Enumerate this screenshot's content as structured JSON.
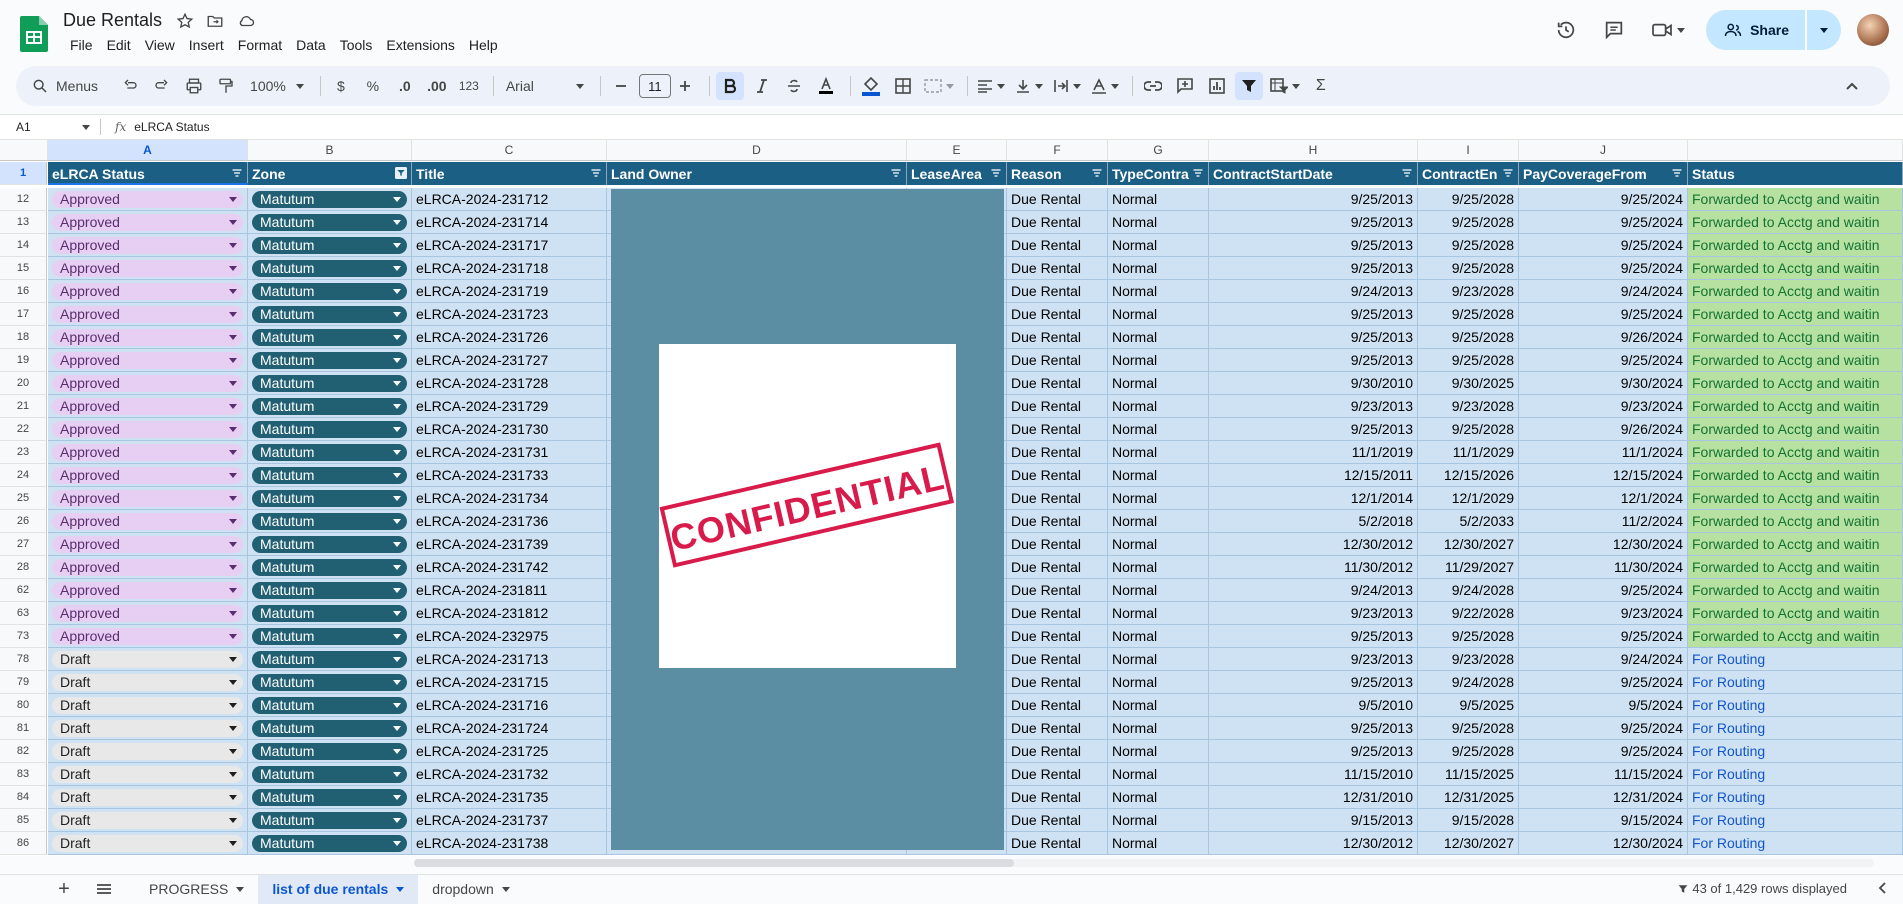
{
  "app": {
    "title": "Due Rentals"
  },
  "menu": [
    "File",
    "Edit",
    "View",
    "Insert",
    "Format",
    "Data",
    "Tools",
    "Extensions",
    "Help"
  ],
  "header": {
    "share_label": "Share"
  },
  "toolbar": {
    "search_label": "Menus",
    "zoom": "100%",
    "currency": "$",
    "percent": "%",
    "dec_dec": ".0",
    "inc_dec": ".00",
    "num_format": "123",
    "font": "Arial",
    "font_size": "11"
  },
  "formula": {
    "cell_ref": "A1",
    "content": "eLRCA Status"
  },
  "columns": [
    "A",
    "B",
    "C",
    "D",
    "E",
    "F",
    "G",
    "H",
    "I",
    "J"
  ],
  "header_row": {
    "row": "1",
    "cells": [
      "eLRCA Status",
      "Zone",
      "Title",
      "Land Owner",
      "LeaseArea",
      "Reason",
      "TypeContra",
      "ContractStartDate",
      "ContractEn",
      "PayCoverageFrom",
      "Status"
    ]
  },
  "rows": [
    {
      "n": "12",
      "status": "Approved",
      "zone": "Matutum",
      "title": "eLRCA-2024-231712",
      "reason": "Due Rental",
      "type": "Normal",
      "start": "9/25/2013",
      "end": "9/25/2028",
      "pay": "9/25/2024",
      "st": "Forwarded to Acctg and waitin"
    },
    {
      "n": "13",
      "status": "Approved",
      "zone": "Matutum",
      "title": "eLRCA-2024-231714",
      "reason": "Due Rental",
      "type": "Normal",
      "start": "9/25/2013",
      "end": "9/25/2028",
      "pay": "9/25/2024",
      "st": "Forwarded to Acctg and waitin"
    },
    {
      "n": "14",
      "status": "Approved",
      "zone": "Matutum",
      "title": "eLRCA-2024-231717",
      "reason": "Due Rental",
      "type": "Normal",
      "start": "9/25/2013",
      "end": "9/25/2028",
      "pay": "9/25/2024",
      "st": "Forwarded to Acctg and waitin"
    },
    {
      "n": "15",
      "status": "Approved",
      "zone": "Matutum",
      "title": "eLRCA-2024-231718",
      "reason": "Due Rental",
      "type": "Normal",
      "start": "9/25/2013",
      "end": "9/25/2028",
      "pay": "9/25/2024",
      "st": "Forwarded to Acctg and waitin"
    },
    {
      "n": "16",
      "status": "Approved",
      "zone": "Matutum",
      "title": "eLRCA-2024-231719",
      "reason": "Due Rental",
      "type": "Normal",
      "start": "9/24/2013",
      "end": "9/23/2028",
      "pay": "9/24/2024",
      "st": "Forwarded to Acctg and waitin"
    },
    {
      "n": "17",
      "status": "Approved",
      "zone": "Matutum",
      "title": "eLRCA-2024-231723",
      "reason": "Due Rental",
      "type": "Normal",
      "start": "9/25/2013",
      "end": "9/25/2028",
      "pay": "9/25/2024",
      "st": "Forwarded to Acctg and waitin"
    },
    {
      "n": "18",
      "status": "Approved",
      "zone": "Matutum",
      "title": "eLRCA-2024-231726",
      "reason": "Due Rental",
      "type": "Normal",
      "start": "9/25/2013",
      "end": "9/25/2028",
      "pay": "9/26/2024",
      "st": "Forwarded to Acctg and waitin"
    },
    {
      "n": "19",
      "status": "Approved",
      "zone": "Matutum",
      "title": "eLRCA-2024-231727",
      "reason": "Due Rental",
      "type": "Normal",
      "start": "9/25/2013",
      "end": "9/25/2028",
      "pay": "9/25/2024",
      "st": "Forwarded to Acctg and waitin"
    },
    {
      "n": "20",
      "status": "Approved",
      "zone": "Matutum",
      "title": "eLRCA-2024-231728",
      "reason": "Due Rental",
      "type": "Normal",
      "start": "9/30/2010",
      "end": "9/30/2025",
      "pay": "9/30/2024",
      "st": "Forwarded to Acctg and waitin"
    },
    {
      "n": "21",
      "status": "Approved",
      "zone": "Matutum",
      "title": "eLRCA-2024-231729",
      "reason": "Due Rental",
      "type": "Normal",
      "start": "9/23/2013",
      "end": "9/23/2028",
      "pay": "9/23/2024",
      "st": "Forwarded to Acctg and waitin"
    },
    {
      "n": "22",
      "status": "Approved",
      "zone": "Matutum",
      "title": "eLRCA-2024-231730",
      "reason": "Due Rental",
      "type": "Normal",
      "start": "9/25/2013",
      "end": "9/25/2028",
      "pay": "9/26/2024",
      "st": "Forwarded to Acctg and waitin"
    },
    {
      "n": "23",
      "status": "Approved",
      "zone": "Matutum",
      "title": "eLRCA-2024-231731",
      "reason": "Due Rental",
      "type": "Normal",
      "start": "11/1/2019",
      "end": "11/1/2029",
      "pay": "11/1/2024",
      "st": "Forwarded to Acctg and waitin"
    },
    {
      "n": "24",
      "status": "Approved",
      "zone": "Matutum",
      "title": "eLRCA-2024-231733",
      "reason": "Due Rental",
      "type": "Normal",
      "start": "12/15/2011",
      "end": "12/15/2026",
      "pay": "12/15/2024",
      "st": "Forwarded to Acctg and waitin"
    },
    {
      "n": "25",
      "status": "Approved",
      "zone": "Matutum",
      "title": "eLRCA-2024-231734",
      "reason": "Due Rental",
      "type": "Normal",
      "start": "12/1/2014",
      "end": "12/1/2029",
      "pay": "12/1/2024",
      "st": "Forwarded to Acctg and waitin"
    },
    {
      "n": "26",
      "status": "Approved",
      "zone": "Matutum",
      "title": "eLRCA-2024-231736",
      "reason": "Due Rental",
      "type": "Normal",
      "start": "5/2/2018",
      "end": "5/2/2033",
      "pay": "11/2/2024",
      "st": "Forwarded to Acctg and waitin"
    },
    {
      "n": "27",
      "status": "Approved",
      "zone": "Matutum",
      "title": "eLRCA-2024-231739",
      "reason": "Due Rental",
      "type": "Normal",
      "start": "12/30/2012",
      "end": "12/30/2027",
      "pay": "12/30/2024",
      "st": "Forwarded to Acctg and waitin"
    },
    {
      "n": "28",
      "status": "Approved",
      "zone": "Matutum",
      "title": "eLRCA-2024-231742",
      "reason": "Due Rental",
      "type": "Normal",
      "start": "11/30/2012",
      "end": "11/29/2027",
      "pay": "11/30/2024",
      "st": "Forwarded to Acctg and waitin"
    },
    {
      "n": "62",
      "status": "Approved",
      "zone": "Matutum",
      "title": "eLRCA-2024-231811",
      "reason": "Due Rental",
      "type": "Normal",
      "start": "9/24/2013",
      "end": "9/24/2028",
      "pay": "9/25/2024",
      "st": "Forwarded to Acctg and waitin"
    },
    {
      "n": "63",
      "status": "Approved",
      "zone": "Matutum",
      "title": "eLRCA-2024-231812",
      "reason": "Due Rental",
      "type": "Normal",
      "start": "9/23/2013",
      "end": "9/22/2028",
      "pay": "9/23/2024",
      "st": "Forwarded to Acctg and waitin"
    },
    {
      "n": "73",
      "status": "Approved",
      "zone": "Matutum",
      "title": "eLRCA-2024-232975",
      "reason": "Due Rental",
      "type": "Normal",
      "start": "9/25/2013",
      "end": "9/25/2028",
      "pay": "9/25/2024",
      "st": "Forwarded to Acctg and waitin"
    },
    {
      "n": "78",
      "status": "Draft",
      "zone": "Matutum",
      "title": "eLRCA-2024-231713",
      "reason": "Due Rental",
      "type": "Normal",
      "start": "9/23/2013",
      "end": "9/23/2028",
      "pay": "9/24/2024",
      "st": "For Routing"
    },
    {
      "n": "79",
      "status": "Draft",
      "zone": "Matutum",
      "title": "eLRCA-2024-231715",
      "reason": "Due Rental",
      "type": "Normal",
      "start": "9/25/2013",
      "end": "9/24/2028",
      "pay": "9/25/2024",
      "st": "For Routing"
    },
    {
      "n": "80",
      "status": "Draft",
      "zone": "Matutum",
      "title": "eLRCA-2024-231716",
      "reason": "Due Rental",
      "type": "Normal",
      "start": "9/5/2010",
      "end": "9/5/2025",
      "pay": "9/5/2024",
      "st": "For Routing"
    },
    {
      "n": "81",
      "status": "Draft",
      "zone": "Matutum",
      "title": "eLRCA-2024-231724",
      "reason": "Due Rental",
      "type": "Normal",
      "start": "9/25/2013",
      "end": "9/25/2028",
      "pay": "9/25/2024",
      "st": "For Routing"
    },
    {
      "n": "82",
      "status": "Draft",
      "zone": "Matutum",
      "title": "eLRCA-2024-231725",
      "reason": "Due Rental",
      "type": "Normal",
      "start": "9/25/2013",
      "end": "9/25/2028",
      "pay": "9/25/2024",
      "st": "For Routing"
    },
    {
      "n": "83",
      "status": "Draft",
      "zone": "Matutum",
      "title": "eLRCA-2024-231732",
      "reason": "Due Rental",
      "type": "Normal",
      "start": "11/15/2010",
      "end": "11/15/2025",
      "pay": "11/15/2024",
      "st": "For Routing"
    },
    {
      "n": "84",
      "status": "Draft",
      "zone": "Matutum",
      "title": "eLRCA-2024-231735",
      "reason": "Due Rental",
      "type": "Normal",
      "start": "12/31/2010",
      "end": "12/31/2025",
      "pay": "12/31/2024",
      "st": "For Routing"
    },
    {
      "n": "85",
      "status": "Draft",
      "zone": "Matutum",
      "title": "eLRCA-2024-231737",
      "reason": "Due Rental",
      "type": "Normal",
      "start": "9/15/2013",
      "end": "9/15/2028",
      "pay": "9/15/2024",
      "st": "For Routing"
    },
    {
      "n": "86",
      "status": "Draft",
      "zone": "Matutum",
      "title": "eLRCA-2024-231738",
      "reason": "Due Rental",
      "type": "Normal",
      "start": "12/30/2012",
      "end": "12/30/2027",
      "pay": "12/30/2024",
      "st": "For Routing"
    }
  ],
  "stamp": {
    "text": "CONFIDENTIAL"
  },
  "sheets": [
    {
      "label": "PROGRESS"
    },
    {
      "label": "list of due rentals"
    },
    {
      "label": "dropdown"
    }
  ],
  "footer": {
    "rows_displayed": "43 of 1,429 rows displayed"
  },
  "colors": {
    "header_bg": "#1c5f85",
    "row_bg": "#cfe2f3",
    "approved_chip": "#e6cff2",
    "zone_chip": "#215f72",
    "forwarded_bg": "#b7e1a1",
    "routing_text": "#1155cc",
    "stamp_red": "#d81b4a",
    "mask": "#5c8ea3"
  }
}
